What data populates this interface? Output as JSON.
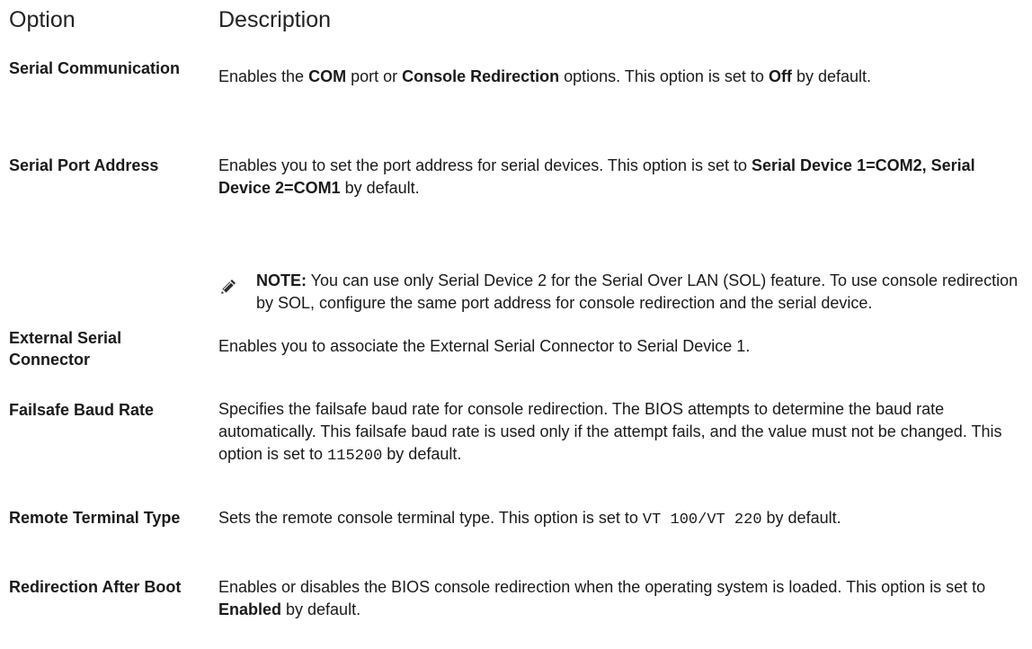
{
  "header": {
    "option": "Option",
    "description": "Description"
  },
  "rows": [
    {
      "option": "Serial Communication",
      "desc": [
        {
          "t": "Enables the "
        },
        {
          "t": "COM",
          "b": true
        },
        {
          "t": " port or "
        },
        {
          "t": "Console Redirection",
          "b": true
        },
        {
          "t": " options. This option is set to "
        },
        {
          "t": "Off",
          "b": true
        },
        {
          "t": " by default."
        }
      ]
    },
    {
      "option": "Serial Port Address",
      "desc": [
        {
          "t": "Enables you to set the port address for serial devices. This option is set to "
        },
        {
          "t": "Serial Device 1=COM2, Serial Device 2=COM1",
          "b": true
        },
        {
          "t": " by default."
        }
      ]
    },
    {
      "option": "External Serial Connector",
      "desc": [
        {
          "t": "Enables you to associate the External Serial Connector to Serial Device 1."
        }
      ]
    },
    {
      "option": "Failsafe Baud Rate",
      "desc": [
        {
          "t": "Specifies the failsafe baud rate for console redirection. The BIOS attempts to determine the baud rate automatically. This failsafe baud rate is used only if the attempt fails, and the value must not be changed. This option is set to "
        },
        {
          "t": "115200",
          "m": true
        },
        {
          "t": " by default."
        }
      ]
    },
    {
      "option": "Remote Terminal Type",
      "desc": [
        {
          "t": "Sets the remote console terminal type. This option is set to "
        },
        {
          "t": "VT 100/VT 220",
          "m": true
        },
        {
          "t": " by default."
        }
      ]
    },
    {
      "option": "Redirection After Boot",
      "desc": [
        {
          "t": "Enables or disables the BIOS console redirection when the operating system is loaded. This option is set to "
        },
        {
          "t": "Enabled",
          "b": true
        },
        {
          "t": " by default."
        }
      ]
    }
  ],
  "note": {
    "icon": "pencil-note-icon",
    "label": "NOTE:",
    "text": " You can use only Serial Device 2 for the Serial Over LAN (SOL) feature. To use console redirection by SOL, configure the same port address for console redirection and the serial device."
  }
}
